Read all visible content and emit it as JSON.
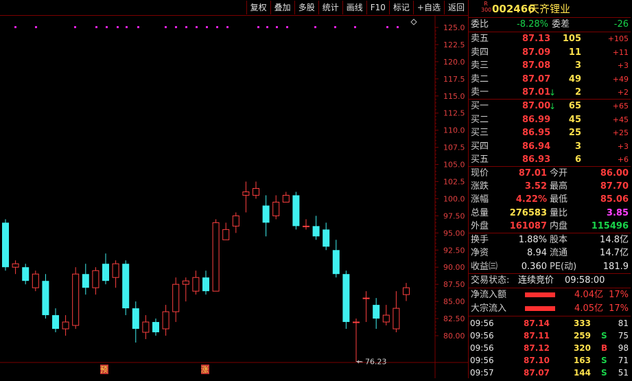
{
  "toolbar": {
    "buttons": [
      "复权",
      "叠加",
      "多股",
      "统计",
      "画线",
      "F10",
      "标记",
      "+自选",
      "返回"
    ]
  },
  "header": {
    "badge_top": "R",
    "badge_bottom": "300",
    "code": "002466",
    "name": "天齐锂业"
  },
  "weibi": {
    "label1": "委比",
    "value1": "-8.28%",
    "label2": "委差",
    "value2": "-26"
  },
  "asks": [
    {
      "label": "卖五",
      "price": "87.13",
      "vol": "105",
      "chg": "+105"
    },
    {
      "label": "卖四",
      "price": "87.09",
      "vol": "11",
      "chg": "+11"
    },
    {
      "label": "卖三",
      "price": "87.08",
      "vol": "3",
      "chg": "+3"
    },
    {
      "label": "卖二",
      "price": "87.07",
      "vol": "49",
      "chg": "+49"
    },
    {
      "label": "卖一",
      "price": "87.01",
      "vol": "2",
      "chg": "+2",
      "arrow": "↓"
    }
  ],
  "bids": [
    {
      "label": "买一",
      "price": "87.00",
      "vol": "65",
      "chg": "+65",
      "arrow": "↓"
    },
    {
      "label": "买二",
      "price": "86.99",
      "vol": "45",
      "chg": "+45"
    },
    {
      "label": "买三",
      "price": "86.95",
      "vol": "25",
      "chg": "+25"
    },
    {
      "label": "买四",
      "price": "86.94",
      "vol": "3",
      "chg": "+3"
    },
    {
      "label": "买五",
      "price": "86.93",
      "vol": "6",
      "chg": "+6"
    }
  ],
  "quote": [
    {
      "l1": "现价",
      "v1": "87.01",
      "c1": "red",
      "l2": "今开",
      "v2": "86.00",
      "c2": "red"
    },
    {
      "l1": "涨跌",
      "v1": "3.52",
      "c1": "red",
      "l2": "最高",
      "v2": "87.70",
      "c2": "red"
    },
    {
      "l1": "涨幅",
      "v1": "4.22%",
      "c1": "red",
      "l2": "最低",
      "v2": "85.06",
      "c2": "red"
    },
    {
      "l1": "总量",
      "v1": "276583",
      "c1": "yellow",
      "l2": "量比",
      "v2": "3.85",
      "c2": "magenta"
    },
    {
      "l1": "外盘",
      "v1": "161087",
      "c1": "red",
      "l2": "内盘",
      "v2": "115496",
      "c2": "green"
    }
  ],
  "fundamentals": [
    {
      "l1": "换手",
      "v1": "1.88%",
      "l2": "股本",
      "v2": "14.8亿"
    },
    {
      "l1": "净资",
      "v1": "8.94",
      "l2": "流通",
      "v2": "14.7亿"
    },
    {
      "l1": "收益㈢",
      "v1": "0.360",
      "l2": "PE(动)",
      "v2": "181.9"
    }
  ],
  "status": {
    "label": "交易状态:",
    "value": "连续竞价",
    "time": "09:58:00"
  },
  "flows": [
    {
      "label": "净流入额",
      "value": "4.04亿",
      "pct": "17%"
    },
    {
      "label": "大宗流入",
      "value": "4.05亿",
      "pct": "17%"
    }
  ],
  "ticks": [
    {
      "time": "09:56",
      "price": "87.14",
      "vol": "333",
      "side": "",
      "count": "81"
    },
    {
      "time": "09:56",
      "price": "87.11",
      "vol": "259",
      "side": "S",
      "count": "75"
    },
    {
      "time": "09:56",
      "price": "87.12",
      "vol": "320",
      "side": "B",
      "count": "98"
    },
    {
      "time": "09:56",
      "price": "87.10",
      "vol": "163",
      "side": "S",
      "count": "71"
    },
    {
      "time": "09:57",
      "price": "87.07",
      "vol": "144",
      "side": "S",
      "count": "51"
    }
  ],
  "chart_data": {
    "type": "candlestick",
    "y_ticks": [
      "125.0",
      "122.5",
      "120.0",
      "117.5",
      "115.0",
      "112.5",
      "110.0",
      "107.5",
      "105.0",
      "102.5",
      "100.0",
      "97.50",
      "95.00",
      "92.50",
      "90.00",
      "87.50",
      "85.00",
      "82.50",
      "80.00"
    ],
    "ylim": [
      77.0,
      126.0
    ],
    "low_annotation": "76.23",
    "markers": [
      "预",
      "涨"
    ],
    "colors": {
      "up": "#ff4040",
      "down": "#3ff0f0",
      "dots": "#e020e0",
      "grid": "#7a0000"
    },
    "candles": [
      {
        "o": 96.5,
        "c": 90.0,
        "h": 97.0,
        "l": 89.5
      },
      {
        "o": 90.0,
        "c": 90.5,
        "h": 91.0,
        "l": 89.0
      },
      {
        "o": 90.0,
        "c": 88.0,
        "h": 90.5,
        "l": 87.5
      },
      {
        "o": 87.0,
        "c": 89.0,
        "h": 89.5,
        "l": 86.5
      },
      {
        "o": 88.0,
        "c": 83.0,
        "h": 89.0,
        "l": 82.5
      },
      {
        "o": 83.0,
        "c": 81.0,
        "h": 84.0,
        "l": 80.5
      },
      {
        "o": 81.0,
        "c": 82.0,
        "h": 83.0,
        "l": 80.0
      },
      {
        "o": 81.5,
        "c": 89.0,
        "h": 90.0,
        "l": 81.0
      },
      {
        "o": 89.0,
        "c": 87.0,
        "h": 90.5,
        "l": 86.0
      },
      {
        "o": 87.0,
        "c": 89.5,
        "h": 90.0,
        "l": 86.0
      },
      {
        "o": 90.5,
        "c": 88.0,
        "h": 92.0,
        "l": 87.5
      },
      {
        "o": 88.5,
        "c": 90.5,
        "h": 91.0,
        "l": 87.0
      },
      {
        "o": 90.5,
        "c": 84.0,
        "h": 91.0,
        "l": 83.0
      },
      {
        "o": 84.0,
        "c": 81.0,
        "h": 85.0,
        "l": 79.0
      },
      {
        "o": 80.5,
        "c": 82.0,
        "h": 83.0,
        "l": 79.5
      },
      {
        "o": 82.0,
        "c": 80.5,
        "h": 82.5,
        "l": 80.0
      },
      {
        "o": 81.0,
        "c": 83.5,
        "h": 84.5,
        "l": 80.0
      },
      {
        "o": 83.5,
        "c": 87.5,
        "h": 88.5,
        "l": 82.0
      },
      {
        "o": 87.5,
        "c": 88.0,
        "h": 88.5,
        "l": 85.0
      },
      {
        "o": 86.5,
        "c": 88.5,
        "h": 89.5,
        "l": 86.0
      },
      {
        "o": 88.5,
        "c": 86.5,
        "h": 89.5,
        "l": 86.0
      },
      {
        "o": 86.5,
        "c": 96.5,
        "h": 97.0,
        "l": 86.5
      },
      {
        "o": 94.0,
        "c": 95.5,
        "h": 96.5,
        "l": 94.0
      },
      {
        "o": 96.0,
        "c": 97.5,
        "h": 98.0,
        "l": 95.0
      },
      {
        "o": 100.5,
        "c": 101.0,
        "h": 102.5,
        "l": 98.0
      },
      {
        "o": 100.5,
        "c": 101.5,
        "h": 102.5,
        "l": 100.0
      },
      {
        "o": 99.0,
        "c": 96.5,
        "h": 100.5,
        "l": 94.5
      },
      {
        "o": 97.5,
        "c": 99.5,
        "h": 100.5,
        "l": 97.0
      },
      {
        "o": 99.5,
        "c": 100.5,
        "h": 101.0,
        "l": 99.5
      },
      {
        "o": 100.5,
        "c": 96.0,
        "h": 101.0,
        "l": 95.5
      },
      {
        "o": 96.0,
        "c": 96.0,
        "h": 97.0,
        "l": 95.5
      },
      {
        "o": 96.0,
        "c": 94.5,
        "h": 97.5,
        "l": 94.0
      },
      {
        "o": 95.5,
        "c": 93.0,
        "h": 96.5,
        "l": 92.5
      },
      {
        "o": 92.5,
        "c": 89.0,
        "h": 94.0,
        "l": 88.5
      },
      {
        "o": 89.0,
        "c": 82.0,
        "h": 89.5,
        "l": 81.0
      },
      {
        "o": 82.0,
        "c": 82.0,
        "h": 82.5,
        "l": 76.2
      },
      {
        "o": 85.5,
        "c": 85.5,
        "h": 86.5,
        "l": 82.0
      },
      {
        "o": 84.5,
        "c": 82.5,
        "h": 85.5,
        "l": 81.0
      },
      {
        "o": 82.0,
        "c": 83.0,
        "h": 84.5,
        "l": 81.5
      },
      {
        "o": 81.0,
        "c": 84.0,
        "h": 86.5,
        "l": 80.5
      },
      {
        "o": 86.0,
        "c": 87.0,
        "h": 87.7,
        "l": 85.06
      }
    ]
  }
}
